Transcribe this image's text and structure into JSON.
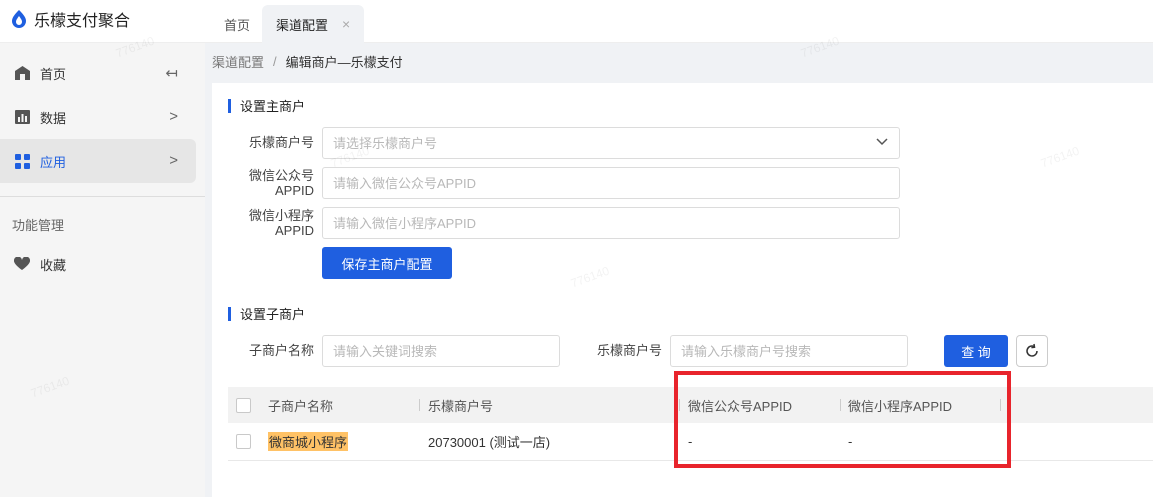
{
  "brand": {
    "name": "乐檬支付聚合",
    "accent": "#1f5fe0"
  },
  "tabs": [
    {
      "label": "首页"
    },
    {
      "label": "渠道配置",
      "close": "×"
    }
  ],
  "sidebar": {
    "items": [
      {
        "label": "首页",
        "icon": "home-icon",
        "collapse_glyph": "↤"
      },
      {
        "label": "数据",
        "icon": "chart-icon",
        "arrow": ">"
      },
      {
        "label": "应用",
        "icon": "apps-icon",
        "arrow": ">"
      }
    ],
    "group_label": "功能管理",
    "favorites": {
      "label": "收藏",
      "icon": "heart-icon"
    }
  },
  "breadcrumb": {
    "parent": "渠道配置",
    "separator": "/",
    "current": "编辑商户—乐檬支付"
  },
  "main_merchant": {
    "title": "设置主商户",
    "merchant_label": "乐檬商户号",
    "merchant_placeholder": "请选择乐檬商户号",
    "wechat_oa_label_line1": "微信公众号",
    "wechat_oa_label_line2": "APPID",
    "wechat_oa_placeholder": "请输入微信公众号APPID",
    "wechat_mp_label_line1": "微信小程序",
    "wechat_mp_label_line2": "APPID",
    "wechat_mp_placeholder": "请输入微信小程序APPID",
    "save_label": "保存主商户配置"
  },
  "sub_merchant": {
    "title": "设置子商户",
    "name_label": "子商户名称",
    "name_placeholder": "请输入关键词搜索",
    "merchant_label": "乐檬商户号",
    "merchant_placeholder": "请输入乐檬商户号搜索",
    "query_label": "查 询"
  },
  "table": {
    "columns": [
      "子商户名称",
      "乐檬商户号",
      "微信公众号APPID",
      "微信小程序APPID"
    ],
    "rows": [
      {
        "name": "微商城小程序",
        "merchant_no": "20730001 (测试一店)",
        "wechat_oa_appid": "-",
        "wechat_mp_appid": "-"
      }
    ]
  },
  "watermark": "776140"
}
